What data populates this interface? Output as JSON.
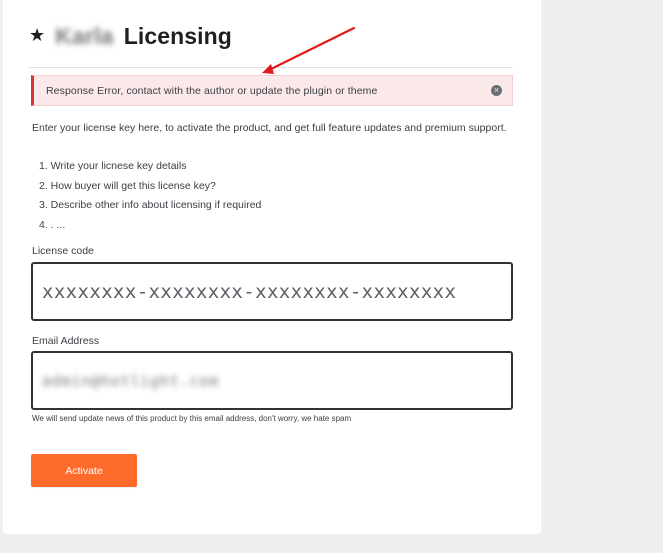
{
  "header": {
    "icon": "star-icon",
    "brand_blurred": "Karla",
    "title": "Licensing"
  },
  "notice": {
    "message": "Response Error, contact with the author or update the plugin or theme",
    "dismiss_icon": "close-circle-icon",
    "accent_color": "#d63638",
    "background_color": "#fbe8e8"
  },
  "description": "Enter your license key here, to activate the product, and get full feature updates and premium support.",
  "steps": [
    "1. Write your licnese key details",
    "2. How buyer will get this license key?",
    "3. Describe other info about licensing if required",
    "4. . ..."
  ],
  "license": {
    "label": "License code",
    "value": "xxxxxxxx-xxxxxxxx-xxxxxxxx-xxxxxxxx"
  },
  "email": {
    "label": "Email Address",
    "value": "admin@hotlight.com",
    "helper": "We will send update news of this product by this email address, don't worry, we hate spam"
  },
  "actions": {
    "activate_label": "Activate",
    "activate_color": "#ff6b2b"
  },
  "annotation": {
    "arrow_color": "#e01b1b"
  }
}
